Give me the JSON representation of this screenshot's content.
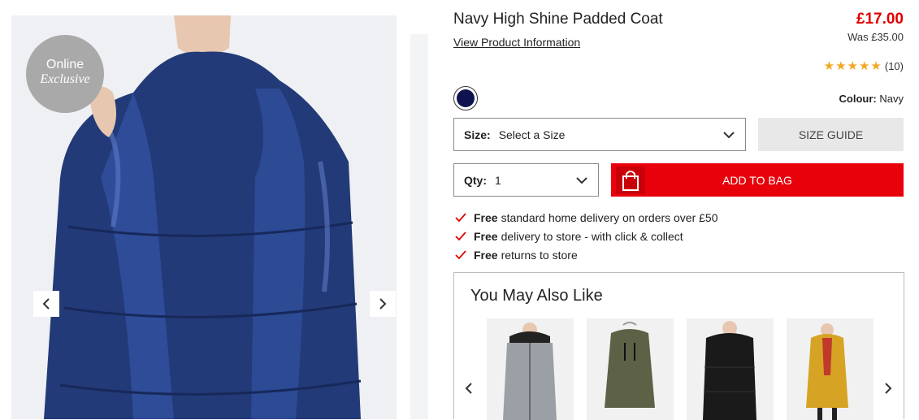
{
  "gallery": {
    "badge_line1": "Online",
    "badge_line2": "Exclusive",
    "prev_icon": "chevron-left-icon",
    "next_icon": "chevron-right-icon"
  },
  "product": {
    "title": "Navy High Shine Padded Coat",
    "info_link": "View Product Information",
    "price": "£17.00",
    "was_price": "Was £35.00",
    "rating": 5,
    "rating_count": "(10)",
    "colour_label": "Colour:",
    "colour_value": "Navy",
    "swatch_color": "#0f1450"
  },
  "size": {
    "label": "Size:",
    "value": "Select a Size",
    "guide_label": "SIZE GUIDE"
  },
  "qty": {
    "label": "Qty:",
    "value": "1"
  },
  "cart": {
    "add_label": "ADD TO BAG",
    "color": "#e8000b"
  },
  "perks": [
    {
      "bold": "Free",
      "text": "standard home delivery on orders over £50"
    },
    {
      "bold": "Free",
      "text": "delivery to store - with click & collect"
    },
    {
      "bold": "Free",
      "text": "returns to store"
    }
  ],
  "recommendations": {
    "title": "You May Also Like",
    "items": [
      {
        "name": "grey-coat",
        "color": "#9aa0a5"
      },
      {
        "name": "khaki-coat",
        "color": "#5d6146"
      },
      {
        "name": "black-coat",
        "color": "#1a1a1a"
      },
      {
        "name": "mustard-coat",
        "color": "#d6a325"
      }
    ]
  }
}
